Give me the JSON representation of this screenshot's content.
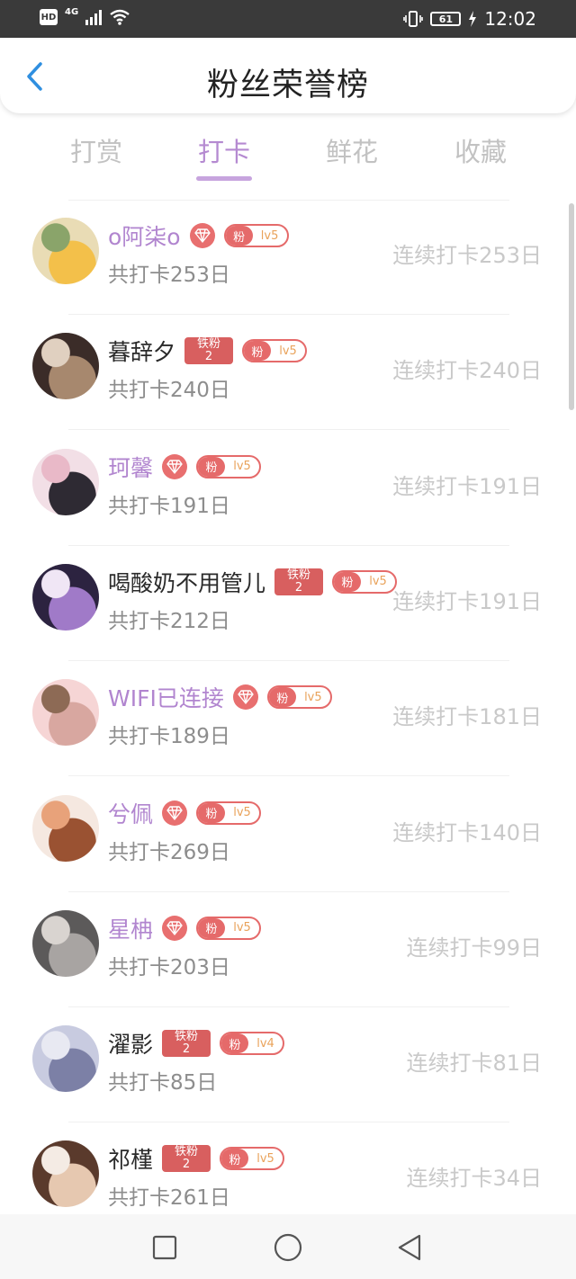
{
  "status_bar": {
    "hd": "HD",
    "network": "4G",
    "battery": "61",
    "time": "12:02"
  },
  "header": {
    "title": "粉丝荣誉榜",
    "back_icon": "chevron-left-icon"
  },
  "tabs": [
    {
      "label": "打赏",
      "active": false
    },
    {
      "label": "打卡",
      "active": true
    },
    {
      "label": "鲜花",
      "active": false
    },
    {
      "label": "收藏",
      "active": false
    }
  ],
  "colors": {
    "accent": "#b185cf",
    "badge_red": "#e56a6a",
    "level_text": "#e9a25a"
  },
  "fans": [
    {
      "name": "o阿柒o",
      "name_purple": true,
      "badge": "diamond",
      "fan_label": "粉",
      "level": "lv5",
      "total": "共打卡253日",
      "streak": "连续打卡253日",
      "avatar_colors": [
        "#e9dcb5",
        "#f3c04a",
        "#8aa46a"
      ]
    },
    {
      "name": "暮辞夕",
      "name_purple": false,
      "badge": "iron",
      "iron_label": "铁粉",
      "iron_num": "2",
      "fan_label": "粉",
      "level": "lv5",
      "total": "共打卡240日",
      "streak": "连续打卡240日",
      "avatar_colors": [
        "#3b2c28",
        "#a7886e",
        "#e0d0c0"
      ]
    },
    {
      "name": "珂馨",
      "name_purple": true,
      "badge": "diamond",
      "fan_label": "粉",
      "level": "lv5",
      "total": "共打卡191日",
      "streak": "连续打卡191日",
      "avatar_colors": [
        "#f2dfe6",
        "#2e2a33",
        "#e9b9c8"
      ]
    },
    {
      "name": "喝酸奶不用管儿",
      "name_purple": false,
      "badge": "iron",
      "iron_label": "铁粉",
      "iron_num": "2",
      "fan_label": "粉",
      "level": "lv5",
      "total": "共打卡212日",
      "streak": "连续打卡191日",
      "avatar_colors": [
        "#2c2340",
        "#a07ac8",
        "#f0e6f5"
      ]
    },
    {
      "name": "WIFI已连接",
      "name_purple": true,
      "badge": "diamond",
      "fan_label": "粉",
      "level": "lv5",
      "total": "共打卡189日",
      "streak": "连续打卡181日",
      "avatar_colors": [
        "#f6d5d5",
        "#d8a7a0",
        "#8d6a55"
      ]
    },
    {
      "name": "兮佩",
      "name_purple": true,
      "badge": "diamond",
      "fan_label": "粉",
      "level": "lv5",
      "total": "共打卡269日",
      "streak": "连续打卡140日",
      "avatar_colors": [
        "#f5e8e0",
        "#9a5232",
        "#e8a27a"
      ]
    },
    {
      "name": "星柟",
      "name_purple": true,
      "badge": "diamond",
      "fan_label": "粉",
      "level": "lv5",
      "total": "共打卡203日",
      "streak": "连续打卡99日",
      "avatar_colors": [
        "#5c5a5a",
        "#a8a4a2",
        "#d9d4d0"
      ]
    },
    {
      "name": "濯影",
      "name_purple": false,
      "badge": "iron",
      "iron_label": "铁粉",
      "iron_num": "2",
      "fan_label": "粉",
      "level": "lv4",
      "total": "共打卡85日",
      "streak": "连续打卡81日",
      "avatar_colors": [
        "#c8cbe0",
        "#7c80a6",
        "#e8e9f2"
      ]
    },
    {
      "name": "祁槿",
      "name_purple": false,
      "badge": "iron",
      "iron_label": "铁粉",
      "iron_num": "2",
      "fan_label": "粉",
      "level": "lv5",
      "total": "共打卡261日",
      "streak": "连续打卡34日",
      "avatar_colors": [
        "#5a3a2c",
        "#e6c8b0",
        "#f4ebe4"
      ]
    }
  ],
  "nav": {
    "recents_icon": "square-icon",
    "home_icon": "circle-icon",
    "back_icon": "triangle-back-icon"
  }
}
